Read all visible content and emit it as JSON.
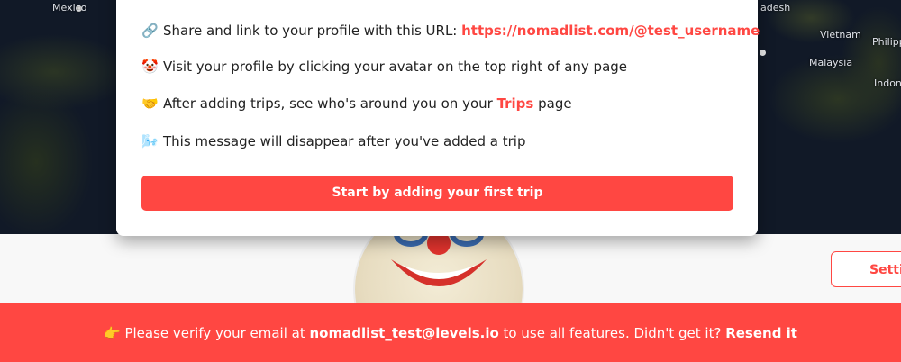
{
  "map": {
    "labels": {
      "mexico": "Mexico",
      "bangladesh": "adesh",
      "vietnam": "Vietnam",
      "philippines": "Philipp",
      "malaysia": "Malaysia",
      "indonesia": "Indon"
    }
  },
  "modal": {
    "items": [
      {
        "icon": "link-icon",
        "emoji": "🔗",
        "text": "Share and link to your profile with this URL: ",
        "link": "https://nomadlist.com/@test_username"
      },
      {
        "icon": "clown-face-icon",
        "emoji": "🤡",
        "text": "Visit your profile by clicking your avatar on the top right of any page"
      },
      {
        "icon": "handshake-icon",
        "emoji": "🤝",
        "text_before": "After adding trips, see who's around you on your ",
        "link": "Trips",
        "text_after": " page"
      },
      {
        "icon": "wind-face-icon",
        "emoji": "🌬️",
        "text": "This message will disappear after you've added a trip"
      }
    ],
    "cta_label": "Start by adding your first trip"
  },
  "profile": {
    "settings_label": "Setti"
  },
  "banner": {
    "icon": "pointing-hand-icon",
    "emoji": "👉",
    "text_before": "Please verify your email at ",
    "email": "nomadlist_test@levels.io",
    "text_middle": " to use all features. Didn't get it? ",
    "resend_label": "Resend it"
  },
  "colors": {
    "accent": "#ff4742",
    "map_background": "#111927"
  }
}
